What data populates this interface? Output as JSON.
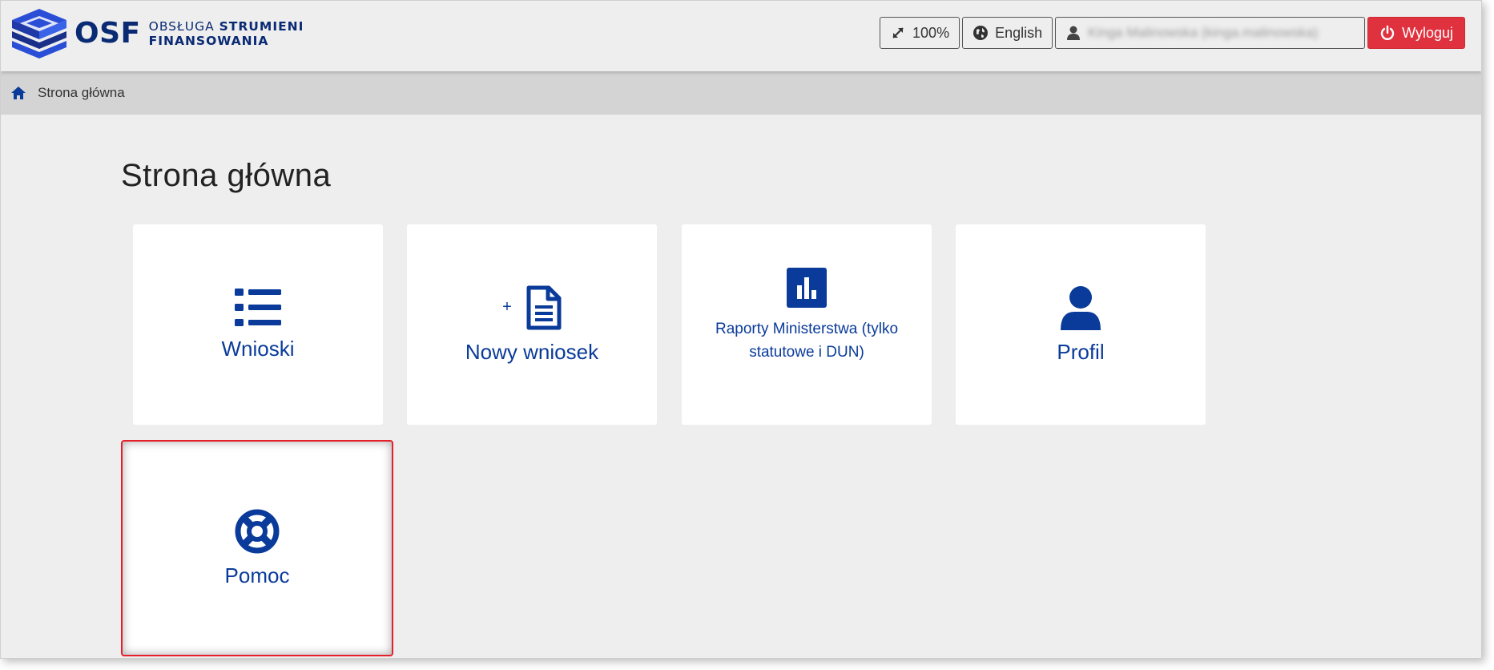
{
  "header": {
    "logo_text": "OSF",
    "logo_sub_light": "OBSŁUGA",
    "logo_sub_bold": "STRUMIENI",
    "logo_sub_line2": "FINANSOWANIA",
    "zoom_label": "100%",
    "language_label": "English",
    "user_label": "Kinga Malinowska (kinga.malinowska)",
    "logout_label": "Wyloguj"
  },
  "breadcrumb": {
    "current": "Strona główna"
  },
  "main": {
    "title": "Strona główna",
    "tiles": [
      {
        "label": "Wnioski",
        "icon": "list-icon"
      },
      {
        "label": "Nowy wniosek",
        "prefix": "+",
        "icon": "new-document-icon"
      },
      {
        "label": "Raporty Ministerstwa (tylko statutowe i DUN)",
        "icon": "bar-chart-icon"
      },
      {
        "label": "Profil",
        "icon": "user-icon"
      },
      {
        "label": "Pomoc",
        "icon": "lifebuoy-icon"
      }
    ]
  },
  "colors": {
    "brand": "#0a2a74",
    "tile_text": "#0a3b9a",
    "logout": "#e0323e",
    "highlight": "#e5202b"
  }
}
